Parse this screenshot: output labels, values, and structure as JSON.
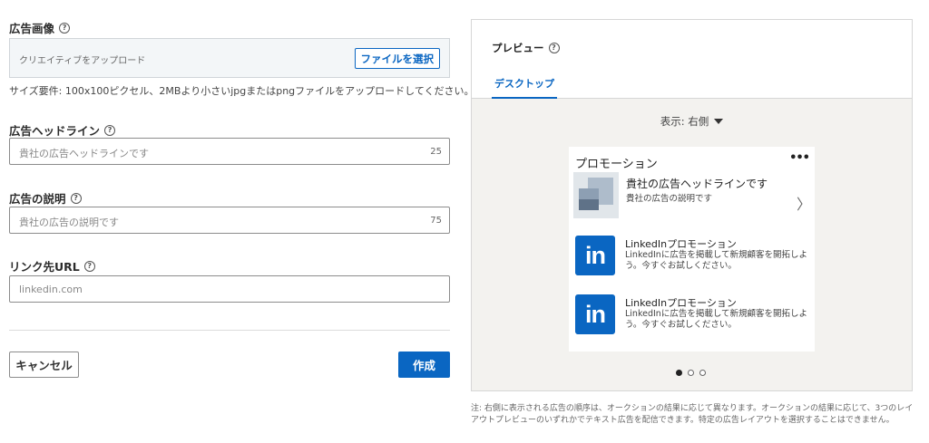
{
  "form": {
    "image_label": "広告画像",
    "upload_placeholder": "クリエイティブをアップロード",
    "file_button": "ファイルを選択",
    "requirements": "サイズ要件: 100x100ピクセル、2MBより小さいjpgまたはpngファイルをアップロードしてください。",
    "headline_label": "広告ヘッドライン",
    "headline_placeholder": "貴社の広告ヘッドラインです",
    "headline_count": "25",
    "description_label": "広告の説明",
    "description_placeholder": "貴社の広告の説明です",
    "description_count": "75",
    "url_label": "リンク先URL",
    "url_placeholder": "linkedin.com",
    "cancel_label": "キャンセル",
    "create_label": "作成"
  },
  "preview": {
    "title": "プレビュー",
    "tab_desktop": "デスクトップ",
    "view_label": "表示: 右側",
    "card": {
      "promo_title": "プロモーション",
      "more": "•••",
      "headline": "貴社の広告ヘッドラインです",
      "description": "貴社の広告の説明です",
      "chevron": "〉",
      "items": [
        {
          "logo": "in",
          "title": "LinkedInプロモーション",
          "desc": "LinkedInに広告を掲載して新規顧客を開拓しよう。今すぐお試しください。"
        },
        {
          "logo": "in",
          "title": "LinkedInプロモーション",
          "desc": "LinkedInに広告を掲載して新規顧客を開拓しよう。今すぐお試しください。"
        }
      ]
    },
    "pager": {
      "total": 3,
      "active_index": 0
    },
    "note": "注: 右側に表示される広告の順序は、オークションの結果に応じて異なります。オークションの結果に応じて、3つのレイアウトプレビューのいずれかでテキスト広告を配信できます。特定の広告レイアウトを選択することはできません。"
  },
  "icons": {
    "help": "help-circle-icon",
    "caret": "caret-down-icon",
    "chevron": "chevron-right-icon",
    "more": "more-horizontal-icon"
  },
  "colors": {
    "accent": "#0a66c2",
    "panel_bg": "#f3f2ef",
    "upload_bg": "#f3f6f8"
  }
}
